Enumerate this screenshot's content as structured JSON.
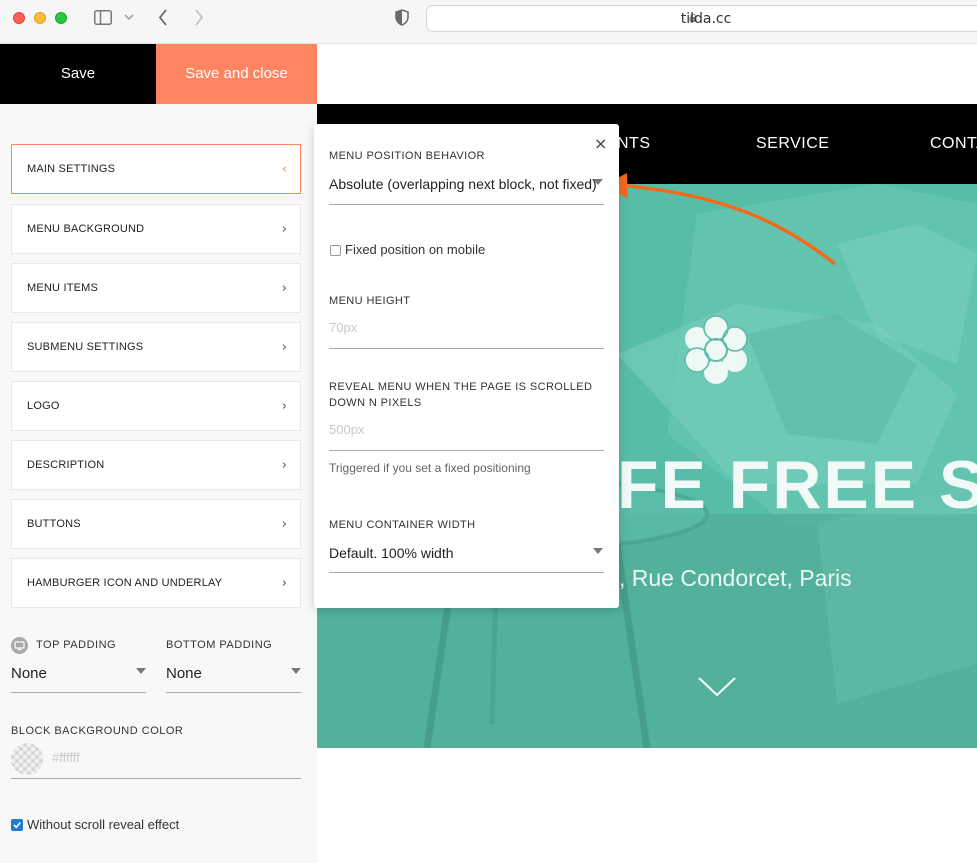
{
  "browser": {
    "url": "tilda.cc"
  },
  "editor": {
    "save_label": "Save",
    "save_close_label": "Save and close",
    "accent_color": "#ff8562",
    "menu": [
      {
        "label": "MAIN SETTINGS",
        "active": true
      },
      {
        "label": "MENU BACKGROUND"
      },
      {
        "label": "MENU ITEMS"
      },
      {
        "label": "SUBMENU SETTINGS"
      },
      {
        "label": "LOGO"
      },
      {
        "label": "DESCRIPTION"
      },
      {
        "label": "BUTTONS"
      },
      {
        "label": "HAMBURGER ICON AND UNDERLAY"
      }
    ],
    "top_padding_label": "TOP PADDING",
    "top_padding_value": "None",
    "bottom_padding_label": "BOTTOM PADDING",
    "bottom_padding_value": "None",
    "bg_color_label": "BLOCK BACKGROUND COLOR",
    "bg_color_placeholder": "#ffffff",
    "scroll_reveal_label": "Without scroll reveal effect",
    "scroll_reveal_checked": true
  },
  "popup": {
    "position_label": "MENU POSITION BEHAVIOR",
    "position_value": "Absolute (overlapping next block, not fixed)",
    "fixed_mobile_label": "Fixed position on mobile",
    "height_label": "MENU HEIGHT",
    "height_placeholder": "70px",
    "reveal_label_line1": "REVEAL MENU WHEN THE PAGE IS SCROLLED",
    "reveal_label_line2": "DOWN N PIXELS",
    "reveal_placeholder": "500px",
    "reveal_hint": "Triggered if you set a fixed positioning",
    "width_label": "MENU CONTAINER WIDTH",
    "width_value": "Default. 100% width",
    "close_glyph": "×"
  },
  "site": {
    "nav": [
      "NTS",
      "SERVICE",
      "CONTA"
    ],
    "hero_title": "FE FREE SP",
    "hero_subtitle": ", Rue Condorcet, Paris",
    "hero_color": "#55b8a4",
    "annotation_arrow_color": "#f26b1d"
  }
}
